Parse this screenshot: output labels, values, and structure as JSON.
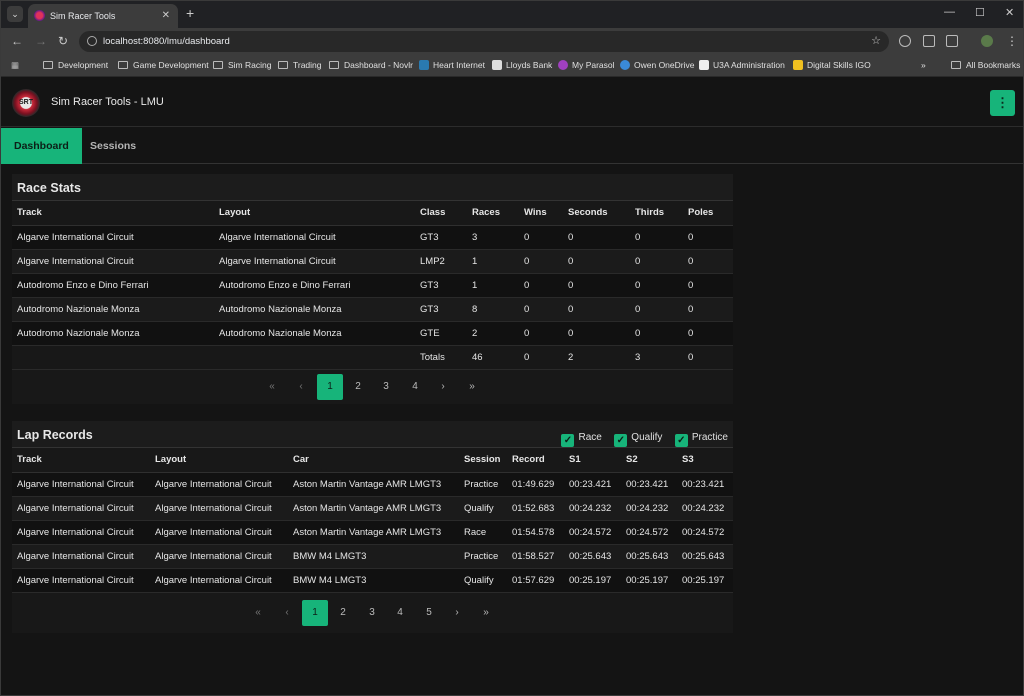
{
  "browser": {
    "tab_title": "Sim Racer Tools",
    "url": "localhost:8080/lmu/dashboard",
    "bookmarks": [
      "Development",
      "Game Development",
      "Sim Racing",
      "Trading",
      "Dashboard - Novlr",
      "Heart Internet",
      "Lloyds Bank",
      "My Parasol",
      "Owen OneDrive",
      "U3A Administration",
      "Digital Skills IGO"
    ],
    "all_bookmarks": "All Bookmarks"
  },
  "app": {
    "logo_text": "SRT",
    "title": "Sim Racer Tools - LMU",
    "tabs": [
      "Dashboard",
      "Sessions"
    ],
    "accent": "#17b47a"
  },
  "race_stats": {
    "title": "Race Stats",
    "columns": [
      "Track",
      "Layout",
      "Class",
      "Races",
      "Wins",
      "Seconds",
      "Thirds",
      "Poles"
    ],
    "rows": [
      [
        "Algarve International Circuit",
        "Algarve International Circuit",
        "GT3",
        "3",
        "0",
        "0",
        "0",
        "0"
      ],
      [
        "Algarve International Circuit",
        "Algarve International Circuit",
        "LMP2",
        "1",
        "0",
        "0",
        "0",
        "0"
      ],
      [
        "Autodromo Enzo e Dino Ferrari",
        "Autodromo Enzo e Dino Ferrari",
        "GT3",
        "1",
        "0",
        "0",
        "0",
        "0"
      ],
      [
        "Autodromo Nazionale Monza",
        "Autodromo Nazionale Monza",
        "GT3",
        "8",
        "0",
        "0",
        "0",
        "0"
      ],
      [
        "Autodromo Nazionale Monza",
        "Autodromo Nazionale Monza",
        "GTE",
        "2",
        "0",
        "0",
        "0",
        "0"
      ]
    ],
    "totals_label": "Totals",
    "totals": [
      "46",
      "0",
      "2",
      "3",
      "0"
    ],
    "pages": [
      "1",
      "2",
      "3",
      "4"
    ],
    "current_page": "1"
  },
  "lap_records": {
    "title": "Lap Records",
    "filters": [
      "Race",
      "Qualify",
      "Practice"
    ],
    "columns": [
      "Track",
      "Layout",
      "Car",
      "Session",
      "Record",
      "S1",
      "S2",
      "S3"
    ],
    "rows": [
      [
        "Algarve International Circuit",
        "Algarve International Circuit",
        "Aston Martin Vantage AMR LMGT3",
        "Practice",
        "01:49.629",
        "00:23.421",
        "00:23.421",
        "00:23.421"
      ],
      [
        "Algarve International Circuit",
        "Algarve International Circuit",
        "Aston Martin Vantage AMR LMGT3",
        "Qualify",
        "01:52.683",
        "00:24.232",
        "00:24.232",
        "00:24.232"
      ],
      [
        "Algarve International Circuit",
        "Algarve International Circuit",
        "Aston Martin Vantage AMR LMGT3",
        "Race",
        "01:54.578",
        "00:24.572",
        "00:24.572",
        "00:24.572"
      ],
      [
        "Algarve International Circuit",
        "Algarve International Circuit",
        "BMW M4 LMGT3",
        "Practice",
        "01:58.527",
        "00:25.643",
        "00:25.643",
        "00:25.643"
      ],
      [
        "Algarve International Circuit",
        "Algarve International Circuit",
        "BMW M4 LMGT3",
        "Qualify",
        "01:57.629",
        "00:25.197",
        "00:25.197",
        "00:25.197"
      ]
    ],
    "pages": [
      "1",
      "2",
      "3",
      "4",
      "5"
    ],
    "current_page": "1"
  },
  "pager_symbols": {
    "first": "«",
    "prev": "‹",
    "next": "›",
    "last": "»"
  }
}
